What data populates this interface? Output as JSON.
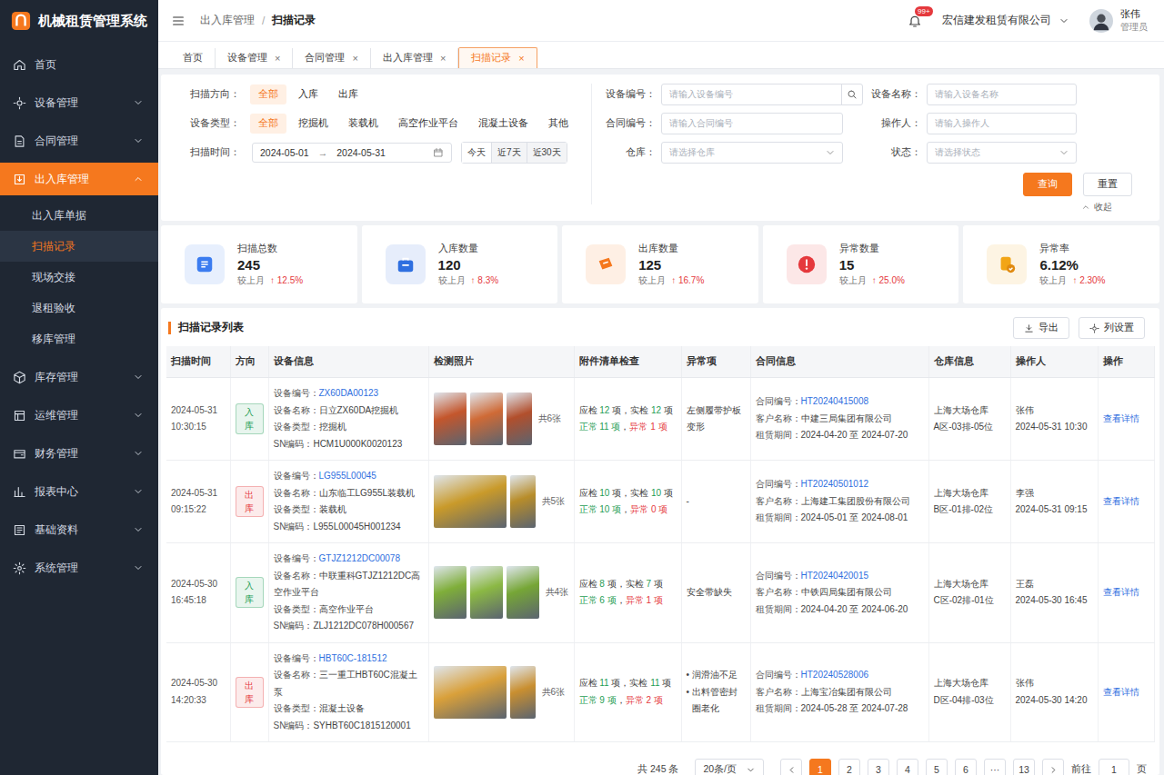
{
  "app": {
    "title": "机械租赁管理系统"
  },
  "sidebar": {
    "items": [
      {
        "label": "首页",
        "expandable": false,
        "expanded": false,
        "selected": false,
        "children": []
      },
      {
        "label": "设备管理",
        "expandable": true,
        "expanded": false,
        "selected": false,
        "children": []
      },
      {
        "label": "合同管理",
        "expandable": true,
        "expanded": false,
        "selected": false,
        "children": []
      },
      {
        "label": "出入库管理",
        "expandable": true,
        "expanded": true,
        "selected": true,
        "children": [
          {
            "label": "出入库单据",
            "selected": false
          },
          {
            "label": "扫描记录",
            "selected": true
          },
          {
            "label": "现场交接",
            "selected": false
          },
          {
            "label": "退租验收",
            "selected": false
          },
          {
            "label": "移库管理",
            "selected": false
          }
        ]
      },
      {
        "label": "库存管理",
        "expandable": true,
        "expanded": false,
        "selected": false,
        "children": []
      },
      {
        "label": "运维管理",
        "expandable": true,
        "expanded": false,
        "selected": false,
        "children": []
      },
      {
        "label": "财务管理",
        "expandable": true,
        "expanded": false,
        "selected": false,
        "children": []
      },
      {
        "label": "报表中心",
        "expandable": true,
        "expanded": false,
        "selected": false,
        "children": []
      },
      {
        "label": "基础资料",
        "expandable": true,
        "expanded": false,
        "selected": false,
        "children": []
      },
      {
        "label": "系统管理",
        "expandable": true,
        "expanded": false,
        "selected": false,
        "children": []
      }
    ]
  },
  "header": {
    "breadcrumb": [
      "出入库管理",
      "扫描记录"
    ],
    "separator": "/",
    "notification_badge": "99+",
    "company": "宏信建发租赁有限公司",
    "user": {
      "name": "张伟",
      "role": "管理员"
    }
  },
  "tabs": {
    "close": "×",
    "items": [
      {
        "label": "首页",
        "closable": false,
        "selected": false
      },
      {
        "label": "设备管理",
        "closable": true,
        "selected": false
      },
      {
        "label": "合同管理",
        "closable": true,
        "selected": false
      },
      {
        "label": "出入库管理",
        "closable": true,
        "selected": false
      },
      {
        "label": "扫描记录",
        "closable": true,
        "selected": true
      }
    ]
  },
  "filters": {
    "direction": {
      "label": "扫描方向：",
      "options": [
        {
          "label": "全部",
          "selected": true
        },
        {
          "label": "入库",
          "selected": false
        },
        {
          "label": "出库",
          "selected": false
        }
      ]
    },
    "type": {
      "label": "设备类型：",
      "options": [
        {
          "label": "全部",
          "selected": true
        },
        {
          "label": "挖掘机",
          "selected": false
        },
        {
          "label": "装载机",
          "selected": false
        },
        {
          "label": "高空作业平台",
          "selected": false
        },
        {
          "label": "混凝土设备",
          "selected": false
        },
        {
          "label": "其他",
          "selected": false
        }
      ]
    },
    "time": {
      "label": "扫描时间：",
      "start": "2024-05-01",
      "arrow": "→",
      "end": "2024-05-31",
      "quick": [
        "今天",
        "近7天",
        "近30天"
      ]
    },
    "fields": [
      {
        "label": "设备编号：",
        "placeholder": "请输入设备编号",
        "kind": "search"
      },
      {
        "label": "设备名称：",
        "placeholder": "请输入设备名称",
        "kind": "input"
      },
      {
        "label": "合同编号：",
        "placeholder": "请输入合同编号",
        "kind": "input"
      },
      {
        "label": "操作人：",
        "placeholder": "请输入操作人",
        "kind": "input"
      },
      {
        "label": "仓库：",
        "placeholder": "请选择仓库",
        "kind": "select"
      },
      {
        "label": "状态：",
        "placeholder": "请选择状态",
        "kind": "select"
      }
    ],
    "query": "查询",
    "reset": "重置",
    "collapse": "收起"
  },
  "stats": [
    {
      "label": "扫描总数",
      "value": "245",
      "compare": "较上月",
      "arrow": "↑",
      "delta": "12.5%",
      "color": "#3b7cf0"
    },
    {
      "label": "入库数量",
      "value": "120",
      "compare": "较上月",
      "arrow": "↑",
      "delta": "8.3%",
      "color": "#2f6fe0"
    },
    {
      "label": "出库数量",
      "value": "125",
      "compare": "较上月",
      "arrow": "↑",
      "delta": "16.7%",
      "color": "#f5781e"
    },
    {
      "label": "异常数量",
      "value": "15",
      "compare": "较上月",
      "arrow": "↑",
      "delta": "25.0%",
      "color": "#e5393d"
    },
    {
      "label": "异常率",
      "value": "6.12%",
      "compare": "较上月",
      "arrow": "↑",
      "delta": "2.30%",
      "color": "#f2a516"
    }
  ],
  "table": {
    "title": "扫描记录列表",
    "export": "导出",
    "settings": "列设置",
    "columns": [
      "扫描时间",
      "方向",
      "设备信息",
      "检测照片",
      "附件清单检查",
      "异常项",
      "合同信息",
      "仓库信息",
      "操作人",
      "操作"
    ],
    "device_labels": {
      "code": "设备编号：",
      "name": "设备名称：",
      "type": "设备类型：",
      "sn": "SN编码："
    },
    "contract_labels": {
      "code": "合同编号：",
      "customer": "客户名称：",
      "period": "租赁期间："
    },
    "check_labels": {
      "expected": "应检",
      "actual": "实检",
      "unit": "项",
      "sep": "，",
      "normal": "正常",
      "abnormal": "异常"
    },
    "bullet": "•",
    "rows": [
      {
        "date": "2024-05-31",
        "time": "10:30:15",
        "direction": {
          "label": "入库",
          "color": "#1f9d55"
        },
        "device": {
          "code": "ZX60DA00123",
          "name": "日立ZX60DA挖掘机",
          "type": "挖掘机",
          "sn": "HCM1U000K0020123"
        },
        "photos": [
          {
            "kind": "square",
            "color": "#c4562c"
          },
          {
            "kind": "square",
            "color": "#cf6a36"
          },
          {
            "kind": "narrow",
            "color": "#b24f2c"
          }
        ],
        "photo_count": "共6张",
        "check": {
          "expected": "12",
          "actual": "12",
          "normal": "11",
          "abnormal": "1"
        },
        "anomalies": [
          "左侧履带护板变形"
        ],
        "contract": {
          "code": "HT20240415008",
          "customer": "中建三局集团有限公司",
          "period": "2024-04-20 至 2024-07-20"
        },
        "warehouse": {
          "name": "上海大场仓库",
          "location": "A区-03排-05位"
        },
        "operator": {
          "name": "张伟",
          "time": "2024-05-31 10:30"
        },
        "action": "查看详情"
      },
      {
        "date": "2024-05-31",
        "time": "09:15:22",
        "direction": {
          "label": "出库",
          "color": "#e5393d"
        },
        "device": {
          "code": "LG955L00045",
          "name": "山东临工LG955L装载机",
          "type": "装载机",
          "sn": "L955L00045H001234"
        },
        "photos": [
          {
            "kind": "wide",
            "color": "#c99a2a"
          },
          {
            "kind": "narrow",
            "color": "#b88d2a"
          }
        ],
        "photo_count": "共5张",
        "check": {
          "expected": "10",
          "actual": "10",
          "normal": "10",
          "abnormal": "0"
        },
        "anomalies": [
          "-"
        ],
        "contract": {
          "code": "HT20240501012",
          "customer": "上海建工集团股份有限公司",
          "period": "2024-05-01 至 2024-08-01"
        },
        "warehouse": {
          "name": "上海大场仓库",
          "location": "B区-01排-02位"
        },
        "operator": {
          "name": "李强",
          "time": "2024-05-31 09:15"
        },
        "action": "查看详情"
      },
      {
        "date": "2024-05-30",
        "time": "16:45:18",
        "direction": {
          "label": "入库",
          "color": "#1f9d55"
        },
        "device": {
          "code": "GTJZ1212DC00078",
          "name": "中联重科GTJZ1212DC高空作业平台",
          "type": "高空作业平台",
          "sn": "ZLJ1212DC078H000567"
        },
        "photos": [
          {
            "kind": "square",
            "color": "#7fae3a"
          },
          {
            "kind": "square",
            "color": "#8bb844"
          },
          {
            "kind": "square",
            "color": "#76a636"
          }
        ],
        "photo_count": "共4张",
        "check": {
          "expected": "8",
          "actual": "7",
          "normal": "6",
          "abnormal": "1"
        },
        "anomalies": [
          "安全带缺失"
        ],
        "contract": {
          "code": "HT20240420015",
          "customer": "中铁四局集团有限公司",
          "period": "2024-04-20 至 2024-06-20"
        },
        "warehouse": {
          "name": "上海大场仓库",
          "location": "C区-02排-01位"
        },
        "operator": {
          "name": "王磊",
          "time": "2024-05-30 16:45"
        },
        "action": "查看详情"
      },
      {
        "date": "2024-05-30",
        "time": "14:20:33",
        "direction": {
          "label": "出库",
          "color": "#e5393d"
        },
        "device": {
          "code": "HBT60C-181512",
          "name": "三一重工HBT60C混凝土泵",
          "type": "混凝土设备",
          "sn": "SYHBT60C1815120001"
        },
        "photos": [
          {
            "kind": "wide",
            "color": "#d9a03a"
          },
          {
            "kind": "narrow",
            "color": "#c98f30"
          }
        ],
        "photo_count": "共6张",
        "check": {
          "expected": "11",
          "actual": "11",
          "normal": "9",
          "abnormal": "2"
        },
        "anomalies": [
          "润滑油不足",
          "出料管密封圈老化"
        ],
        "contract": {
          "code": "HT20240528006",
          "customer": "上海宝冶集团有限公司",
          "period": "2024-05-28 至 2024-07-28"
        },
        "warehouse": {
          "name": "上海大场仓库",
          "location": "D区-04排-03位"
        },
        "operator": {
          "name": "张伟",
          "time": "2024-05-30 14:20"
        },
        "action": "查看详情"
      }
    ]
  },
  "pagination": {
    "total": "共 245 条",
    "page_size": "20条/页",
    "pages": [
      {
        "label": "1",
        "selected": true
      },
      {
        "label": "2",
        "selected": false
      },
      {
        "label": "3",
        "selected": false
      },
      {
        "label": "4",
        "selected": false
      },
      {
        "label": "5",
        "selected": false
      },
      {
        "label": "6",
        "selected": false
      },
      {
        "label": "···",
        "selected": false
      },
      {
        "label": "13",
        "selected": false
      }
    ],
    "goto": "前往",
    "goto_value": "1",
    "page_unit": "页"
  }
}
